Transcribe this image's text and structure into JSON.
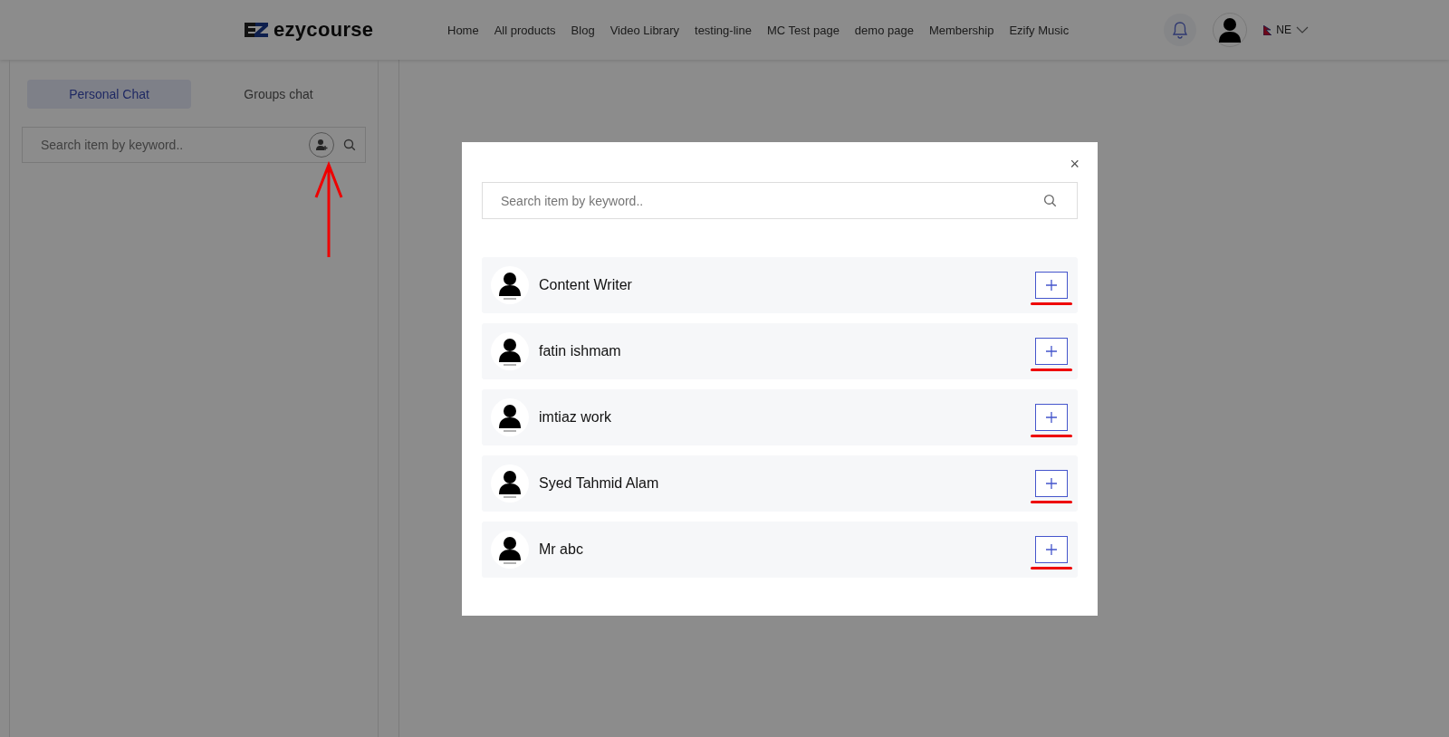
{
  "header": {
    "logo": "ezycourse",
    "nav": [
      "Home",
      "All products",
      "Blog",
      "Video Library",
      "testing-line",
      "MC Test page",
      "demo page",
      "Membership",
      "Ezify Music"
    ],
    "language": "NE"
  },
  "sidebar": {
    "tabs": [
      {
        "label": "Personal Chat",
        "selected": true
      },
      {
        "label": "Groups chat",
        "selected": false
      }
    ],
    "search": {
      "placeholder": "Search item by keyword.."
    },
    "annotated": true
  },
  "modal": {
    "search": {
      "placeholder": "Search item by keyword.."
    },
    "close": "×",
    "users": [
      {
        "name": "Content Writer",
        "underlined": true
      },
      {
        "name": "fatin ishmam",
        "underlined": true
      },
      {
        "name": "imtiaz work",
        "underlined": true
      },
      {
        "name": "Syed Tahmid Alam",
        "underlined": true
      },
      {
        "name": "Mr abc",
        "underlined": true
      }
    ]
  }
}
